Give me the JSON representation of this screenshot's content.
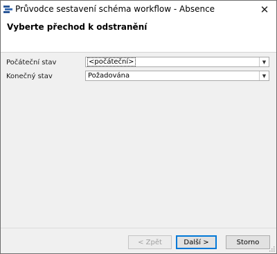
{
  "window": {
    "title": "Průvodce sestavení schéma workflow - Absence",
    "close_glyph": "✕",
    "icon": "workflow-app-icon"
  },
  "header": {
    "title": "Vyberte přechod k odstranění"
  },
  "form": {
    "start_state": {
      "label": "Počáteční stav",
      "value": "<počáteční>"
    },
    "end_state": {
      "label": "Konečný stav",
      "value": "Požadována"
    }
  },
  "buttons": {
    "back": "< Zpět",
    "next": "Další >",
    "cancel": "Storno"
  },
  "colors": {
    "default_button_border": "#0078d7",
    "app_icon": "#2b5797"
  }
}
